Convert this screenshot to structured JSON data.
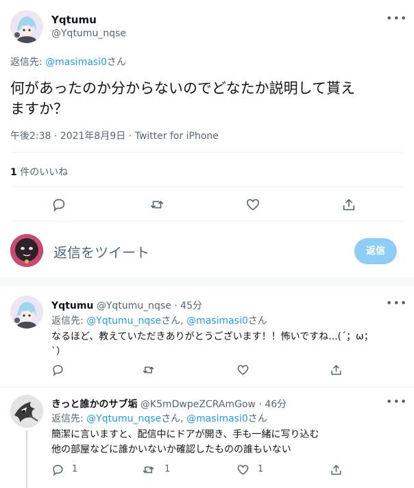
{
  "main_tweet": {
    "author_name": "Yqtumu",
    "author_handle": "@Yqtumu_nqse",
    "reply_to_prefix": "返信先: ",
    "reply_to_handle": "@masimasi0",
    "reply_to_suffix": "さん",
    "text_line1": "何があったのか分からないのでどなたか説明して貰え",
    "text_line2": "ますか？",
    "timestamp": "午後2:38 · 2021年8月9日 · Twitter for iPhone",
    "like_count": "1",
    "like_label": " 件のいいね"
  },
  "reply_box": {
    "placeholder": "返信をツイート",
    "button_label": "返信"
  },
  "replies": [
    {
      "author_name": "Yqtumu",
      "author_handle": "@Yqtumu_nqse",
      "age": " · 45分",
      "reply_to_prefix": "返信先: ",
      "reply_to_handle1": "@Yqtumu_nqse",
      "reply_to_mid": "さん, ",
      "reply_to_handle2": "@masimasi0",
      "reply_to_suffix": "さん",
      "text_line1": "なるほど、教えていただきありがとうございます！！怖いですね...(´；ω；",
      "text_line2": "`）"
    },
    {
      "author_name": "きっと誰かのサブ垢",
      "author_handle": "@K5mDwpeZCRAmGow",
      "age": " · 46分",
      "reply_to_prefix": "返信先: ",
      "reply_to_handle1": "@Yqtumu_nqse",
      "reply_to_mid": "さん, ",
      "reply_to_handle2": "@masimasi0",
      "reply_to_suffix": "さん",
      "text_line1": "簡潔に言いますと、配信中にドアが開き、手も一緒に写り込む",
      "text_line2": "他の部屋などに誰かいないか確認したものの誰もいない",
      "reply_count": "1",
      "retweet_count": "1",
      "like_count": "1"
    }
  ],
  "colors": {
    "accent": "#1d9bf0",
    "button_disabled": "#8ecdf8",
    "text": "#0f1419",
    "muted": "#536471",
    "divider": "#eff3f4"
  }
}
